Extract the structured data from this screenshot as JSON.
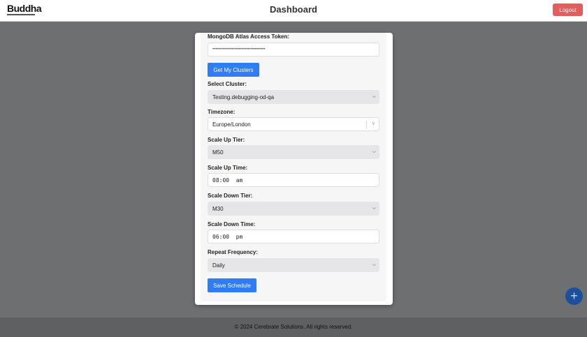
{
  "header": {
    "logo": "Buddha",
    "title": "Dashboard",
    "logout_label": "Logout"
  },
  "form": {
    "token_label": "MongoDB Atlas Access Token:",
    "token_value": "••••••••••••••••••••••••••••••••••••",
    "get_clusters_label": "Get My Clusters",
    "cluster_label": "Select Cluster:",
    "cluster_value": "Testing.debugging-od-qa",
    "timezone_label": "Timezone:",
    "timezone_value": "Europe/London",
    "scale_up_tier_label": "Scale Up Tier:",
    "scale_up_tier_value": "M50",
    "scale_up_time_label": "Scale Up Time:",
    "scale_up_time_value": "08:00  am",
    "scale_down_tier_label": "Scale Down Tier:",
    "scale_down_tier_value": "M30",
    "scale_down_time_label": "Scale Down Time:",
    "scale_down_time_value": "06:00  pm",
    "repeat_label": "Repeat Frequency:",
    "repeat_value": "Daily",
    "save_label": "Save Schedule"
  },
  "footer": {
    "text": "© 2024 Cerebrate Solutions. All rights reserved."
  },
  "fab": {
    "icon": "+"
  }
}
